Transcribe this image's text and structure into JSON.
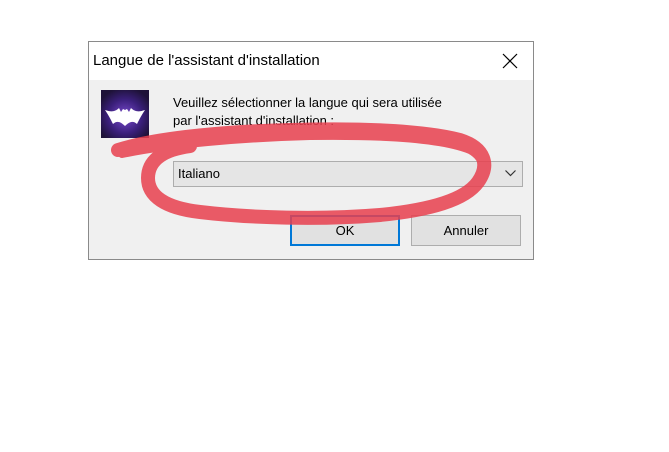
{
  "dialog": {
    "title": "Langue de l'assistant d'installation",
    "close_icon": "close-icon",
    "app_icon": "bat-logo-icon",
    "prompt_line1": "Veuillez sélectionner la langue qui sera utilisée",
    "prompt_line2": "par l'assistant d'installation :",
    "language_select": {
      "selected": "Italiano",
      "arrow_icon": "chevron-down-icon"
    },
    "ok_label": "OK",
    "cancel_label": "Annuler"
  },
  "colors": {
    "annotation": "#e8404f",
    "focus_border": "#0078d7",
    "icon_bg": "#2a1a4e"
  }
}
